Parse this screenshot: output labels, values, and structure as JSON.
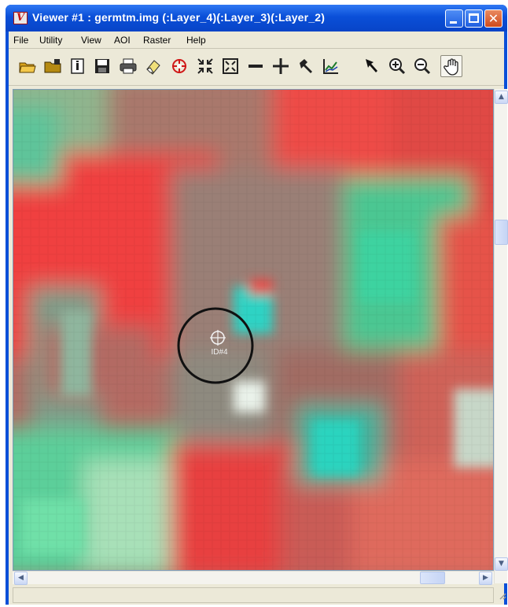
{
  "window": {
    "title": "Viewer #1 : germtm.img (:Layer_4)(:Layer_3)(:Layer_2)",
    "app_icon": "viewer-app-icon",
    "controls": [
      "minimize-icon",
      "maximize-icon",
      "close-icon"
    ]
  },
  "menu": {
    "items": [
      {
        "label": "File"
      },
      {
        "label": "Utility"
      },
      {
        "label": "View"
      },
      {
        "label": "AOI"
      },
      {
        "label": "Raster"
      },
      {
        "label": "Help"
      }
    ]
  },
  "toolbar": {
    "tools": [
      {
        "icon": "open-folder-icon"
      },
      {
        "icon": "close-layer-folder-icon"
      },
      {
        "icon": "layer-info-icon"
      },
      {
        "icon": "save-icon"
      },
      {
        "icon": "print-icon"
      },
      {
        "icon": "eraser-icon"
      },
      {
        "icon": "inquire-cursor-icon"
      },
      {
        "icon": "zoom-in-arrows-icon"
      },
      {
        "icon": "zoom-out-arrows-icon"
      },
      {
        "icon": "minus-icon"
      },
      {
        "icon": "crosshair-plus-icon"
      },
      {
        "icon": "edit-hammer-icon"
      },
      {
        "icon": "profile-chart-icon"
      },
      {
        "icon": "select-pointer-icon"
      },
      {
        "icon": "zoom-in-magnifier-icon"
      },
      {
        "icon": "zoom-out-magnifier-icon"
      },
      {
        "icon": "pan-hand-icon",
        "pressed": true
      }
    ]
  },
  "image": {
    "annotation_label": "ID#4",
    "colors": {
      "vegetation_red": "#f04a45",
      "bare_gray": "#9a7f76",
      "water_cyan": "#2fd3c4",
      "field_green": "#4ec89a",
      "annotation_circle": "#111111",
      "annotation_marker": "#f2f2f2"
    }
  },
  "scrollbars": {
    "up_arrow": "▲",
    "down_arrow": "▼",
    "left_arrow": "◀",
    "right_arrow": "▶"
  }
}
